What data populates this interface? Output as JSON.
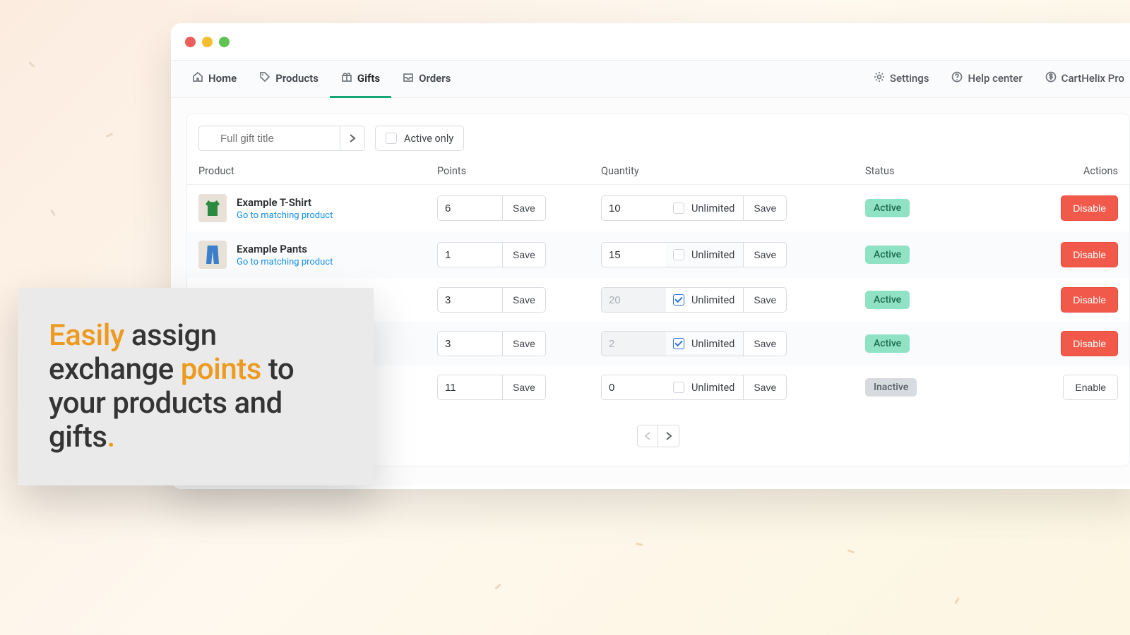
{
  "nav": {
    "left": [
      {
        "label": "Home",
        "name": "nav-home",
        "icon": "home-icon"
      },
      {
        "label": "Products",
        "name": "nav-products",
        "icon": "tag-icon"
      },
      {
        "label": "Gifts",
        "name": "nav-gifts",
        "icon": "gift-icon",
        "active": true
      },
      {
        "label": "Orders",
        "name": "nav-orders",
        "icon": "inbox-icon"
      }
    ],
    "right": [
      {
        "label": "Settings",
        "name": "nav-settings",
        "icon": "gear-icon"
      },
      {
        "label": "Help center",
        "name": "nav-help-center",
        "icon": "help-icon"
      },
      {
        "label": "CartHelix Pro",
        "name": "nav-upgrade",
        "icon": "dollar-icon"
      }
    ]
  },
  "filters": {
    "search_placeholder": "Full gift title",
    "active_only_label": "Active only",
    "active_only_checked": false
  },
  "columns": {
    "product": "Product",
    "points": "Points",
    "quantity": "Quantity",
    "status": "Status",
    "actions": "Actions"
  },
  "labels": {
    "save": "Save",
    "unlimited": "Unlimited",
    "disable": "Disable",
    "enable": "Enable",
    "go_to_product": "Go to matching product"
  },
  "status_labels": {
    "active": "Active",
    "inactive": "Inactive"
  },
  "rows": [
    {
      "title": "Example T-Shirt",
      "thumb": "tshirt",
      "show_product": true,
      "points": "6",
      "quantity": "10",
      "unlimited": false,
      "status": "active"
    },
    {
      "title": "Example Pants",
      "thumb": "pants",
      "show_product": true,
      "points": "1",
      "quantity": "15",
      "unlimited": false,
      "status": "active"
    },
    {
      "title": "",
      "thumb": "",
      "show_product": false,
      "points": "3",
      "quantity": "20",
      "unlimited": true,
      "status": "active"
    },
    {
      "title": "",
      "thumb": "",
      "show_product": false,
      "points": "3",
      "quantity": "2",
      "unlimited": true,
      "status": "active"
    },
    {
      "title": "",
      "thumb": "",
      "show_product": false,
      "points": "11",
      "quantity": "0",
      "unlimited": false,
      "status": "inactive"
    }
  ],
  "callout": {
    "w1": "Easily",
    "t1": " assign exchange ",
    "w2": "points",
    "t2": " to your products and gifts",
    "dot": "."
  }
}
